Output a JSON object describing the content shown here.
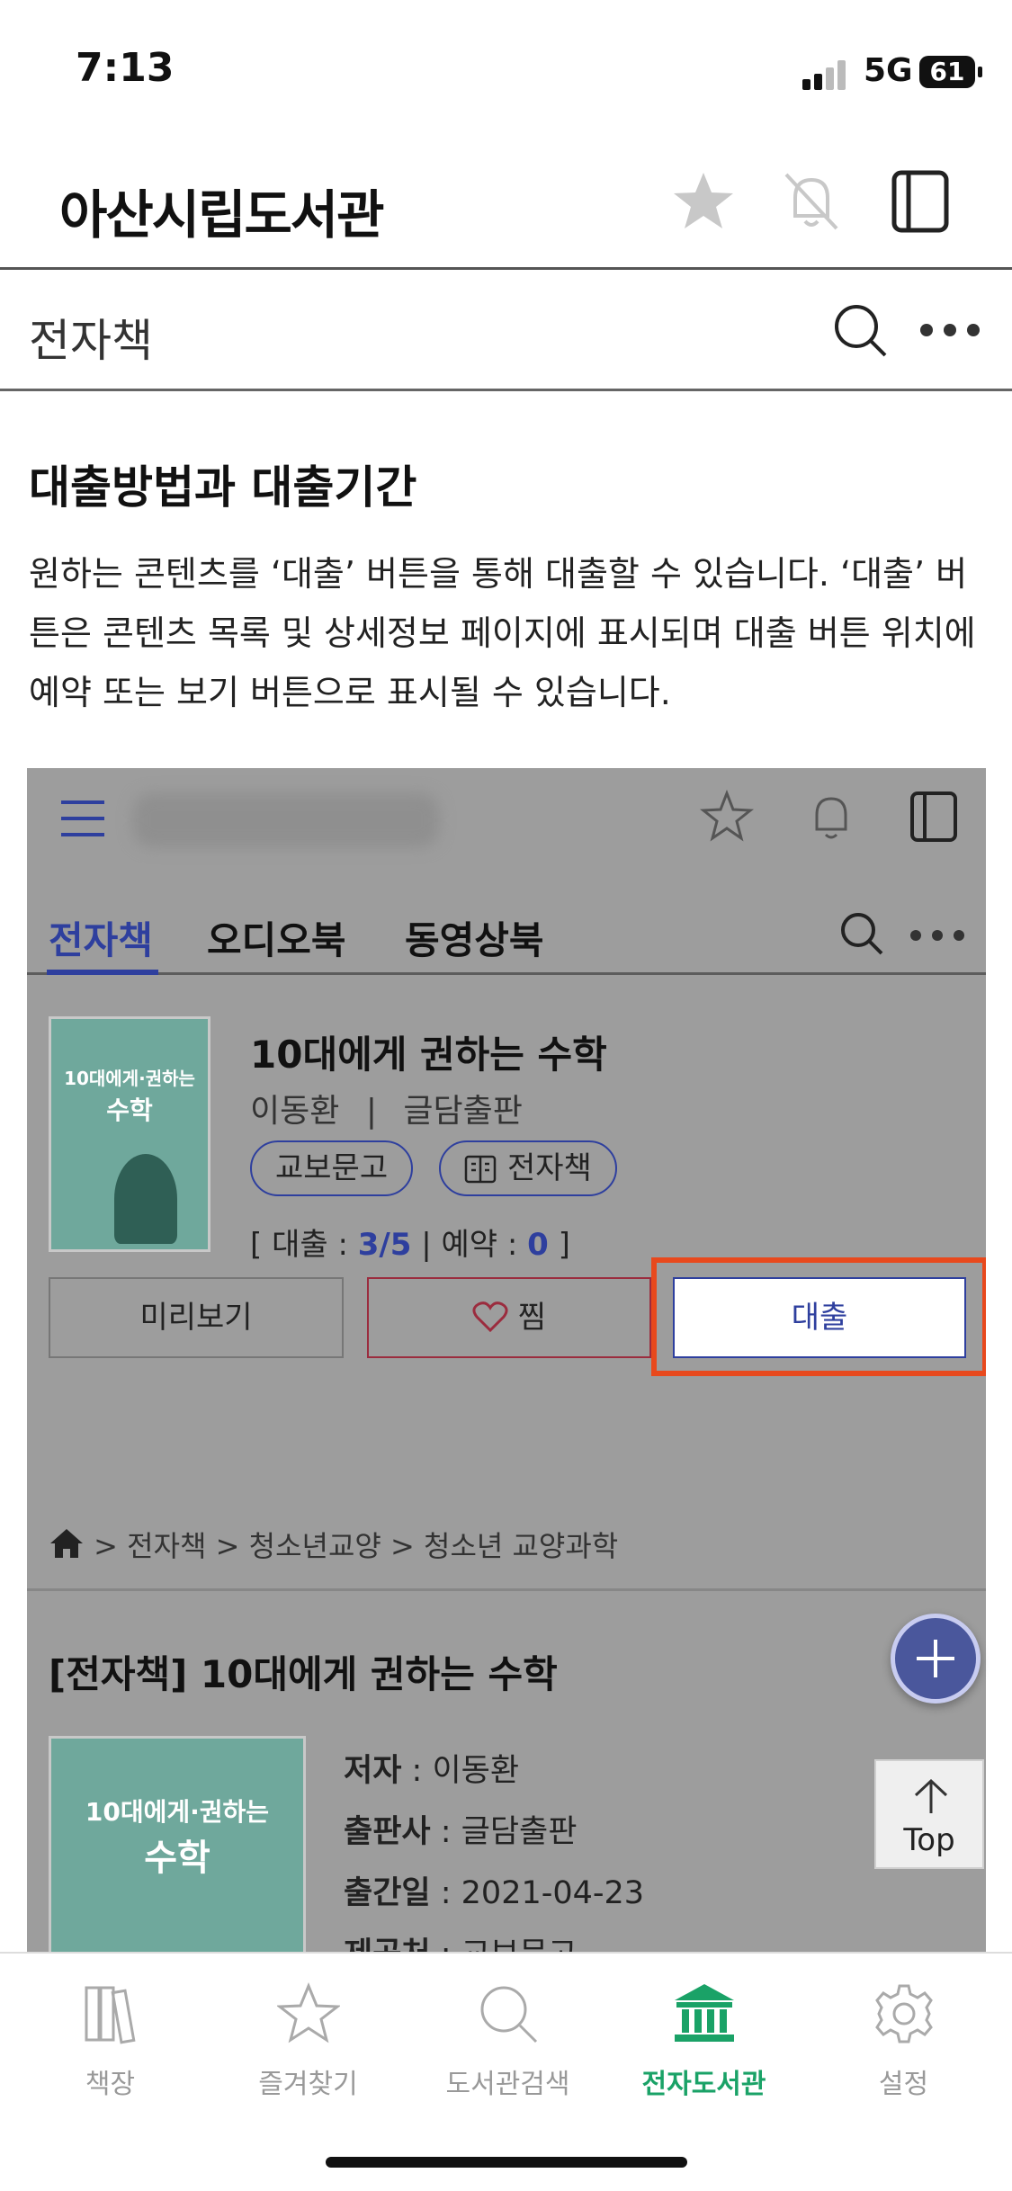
{
  "status_bar": {
    "time": "7:13",
    "network": "5G",
    "battery": "61"
  },
  "header": {
    "title": "아산시립도서관"
  },
  "subheader": {
    "title": "전자책"
  },
  "section": {
    "title": "대출방법과 대출기간",
    "description": "원하는 콘텐츠를 ‘대출’ 버튼을 통해 대출할 수 있습니다. ‘대출’ 버튼은 콘텐츠 목록 및 상세정보 페이지에 표시되며 대출 버튼 위치에 예약 또는 보기 버튼으로 표시될 수 있습니다."
  },
  "figure": {
    "tabs": [
      "전자책",
      "오디오북",
      "동영상북"
    ],
    "cover_text": [
      "10대에게·권하는",
      "수학"
    ],
    "book": {
      "title": "10대에게 권하는 수학",
      "author": "이동환",
      "separator": "|",
      "publisher": "글담출판",
      "chip_provider": "교보문고",
      "chip_type": "전자책",
      "loan_label": "[ 대출 : ",
      "loan_value": "3/5",
      "reserve_label": " |   예약 : ",
      "reserve_value": "0",
      "close_bracket": " ]"
    },
    "buttons": {
      "preview": "미리보기",
      "like": "찜",
      "loan": "대출"
    },
    "breadcrumb": [
      "전자책",
      "청소년교양",
      "청소년 교양과학"
    ],
    "breadcrumb_sep": " > ",
    "detail": {
      "title": "[전자책] 10대에게 권하는 수학",
      "author_label": "저자",
      "author_value": " : 이동환",
      "publisher_label": "출판사",
      "publisher_value": " : 글담출판",
      "date_label": "출간일",
      "date_value": " : 2021-04-23",
      "provider_label": "제공처",
      "provider_value": " : 교보문고"
    },
    "top_label": "Top"
  },
  "tabbar": {
    "items": [
      {
        "label": "책장",
        "icon": "bookshelf-icon"
      },
      {
        "label": "즐겨찾기",
        "icon": "star-icon"
      },
      {
        "label": "도서관검색",
        "icon": "search-icon"
      },
      {
        "label": "전자도서관",
        "icon": "library-icon"
      },
      {
        "label": "설정",
        "icon": "gear-icon"
      }
    ],
    "active_index": 3
  },
  "colors": {
    "accent_green": "#1aa267",
    "figure_blue": "#2e3f9e",
    "highlight": "#e8491d"
  }
}
